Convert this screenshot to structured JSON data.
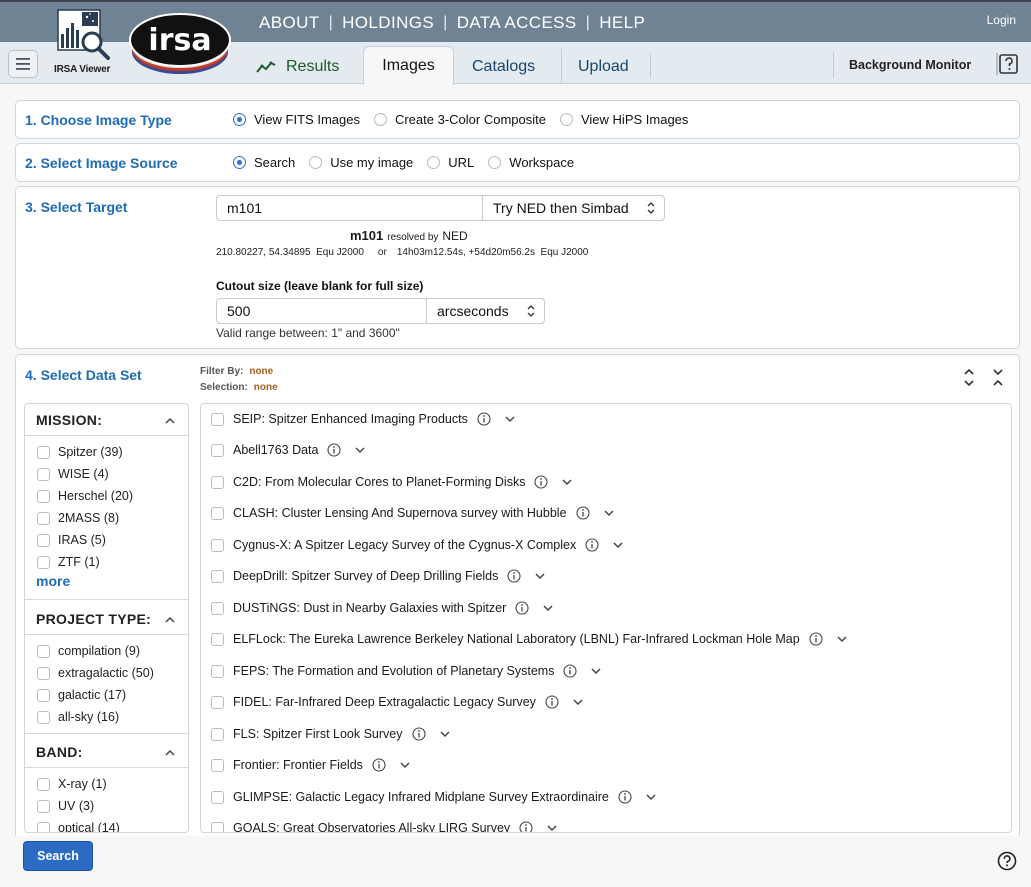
{
  "banner": {
    "nav": [
      "About",
      "Holdings",
      "Data access",
      "Help"
    ],
    "login": "Login",
    "viewer_label": "IRSA Viewer",
    "logo_text": "irsa"
  },
  "tabs": {
    "results": "Results",
    "images": "Images",
    "catalogs": "Catalogs",
    "upload": "Upload",
    "background_monitor": "Background Monitor",
    "active": "Images"
  },
  "step1": {
    "title": "1. Choose Image Type",
    "options": [
      "View FITS Images",
      "Create 3-Color Composite",
      "View HiPS Images"
    ],
    "selected": "View FITS Images"
  },
  "step2": {
    "title": "2. Select Image Source",
    "options": [
      "Search",
      "Use my image",
      "URL",
      "Workspace"
    ],
    "selected": "Search"
  },
  "step3": {
    "title": "3. Select Target",
    "target_value": "m101",
    "resolver": "Try NED then Simbad",
    "resolved_name": "m101",
    "resolved_by": "resolved by",
    "resolver_name": "NED",
    "coords_decimal": "210.80227, 54.34895  Equ J2000",
    "or": "or",
    "coords_sexagesimal": "14h03m12.54s, +54d20m56.2s  Equ J2000",
    "cutout_label": "Cutout size (leave blank for full size)",
    "cutout_value": "500",
    "cutout_unit": "arcseconds",
    "valid_range": "Valid range between: 1\" and 3600\""
  },
  "step4": {
    "title": "4. Select Data Set",
    "filter_by_label": "Filter By:",
    "filter_by_value": "none",
    "selection_label": "Selection:",
    "selection_value": "none",
    "facets": {
      "mission": {
        "title": "MISSION:",
        "items": [
          "Spitzer (39)",
          "WISE (4)",
          "Herschel (20)",
          "2MASS (8)",
          "IRAS (5)",
          "ZTF (1)"
        ],
        "more": "more"
      },
      "project_type": {
        "title": "PROJECT TYPE:",
        "items": [
          "compilation (9)",
          "extragalactic (50)",
          "galactic (17)",
          "all-sky (16)"
        ]
      },
      "band": {
        "title": "BAND:",
        "items": [
          "X-ray (1)",
          "UV (3)",
          "optical (14)"
        ]
      }
    },
    "datasets": [
      "SEIP: Spitzer Enhanced Imaging Products",
      "Abell1763 Data",
      "C2D: From Molecular Cores to Planet-Forming Disks",
      "CLASH: Cluster Lensing And Supernova survey with Hubble",
      "Cygnus-X: A Spitzer Legacy Survey of the Cygnus-X Complex",
      "DeepDrill: Spitzer Survey of Deep Drilling Fields",
      "DUSTiNGS: Dust in Nearby Galaxies with Spitzer",
      "ELFLock: The Eureka Lawrence Berkeley National Laboratory (LBNL) Far-Infrared Lockman Hole Map",
      "FEPS: The Formation and Evolution of Planetary Systems",
      "FIDEL: Far-Infrared Deep Extragalactic Legacy Survey",
      "FLS: Spitzer First Look Survey",
      "Frontier: Frontier Fields",
      "GLIMPSE: Galactic Legacy Infrared Midplane Survey Extraordinaire",
      "GOALS: Great Observatories All-sky LIRG Survey"
    ]
  },
  "footer": {
    "search_button": "Search"
  },
  "colors": {
    "banner": "#6f8394",
    "accent": "#1f6bb5",
    "results_green": "#1d5b2a",
    "search_button": "#2c6bc4",
    "filter_value": "#a0611e"
  },
  "icons": [
    "hamburger-icon",
    "viewer-logo-icon",
    "trend-chart-icon",
    "help-window-icon",
    "info-icon",
    "chevron-down-icon",
    "chevron-up-icon",
    "expand-all-icon",
    "collapse-all-icon",
    "help-circle-icon"
  ]
}
